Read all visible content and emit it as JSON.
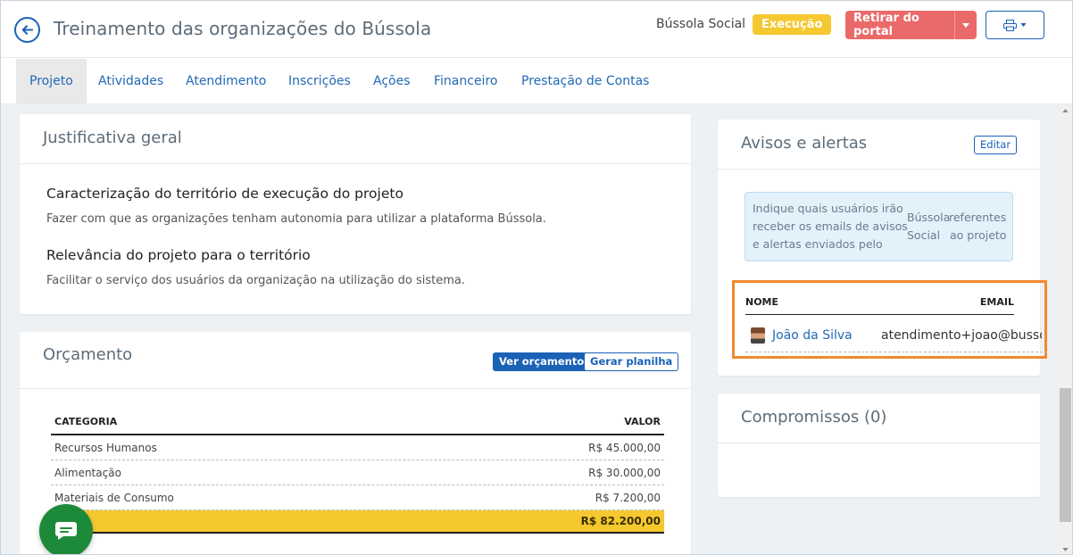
{
  "header": {
    "title": "Treinamento das organizações do Bússola",
    "org_name": "Bússola Social",
    "status": "Execução",
    "portal_button": "Retirar do portal",
    "icons": {
      "back": "arrow-left-circle-icon",
      "print": "printer-icon",
      "caret": "chevron-down-icon"
    }
  },
  "tabs": [
    {
      "label": "Projeto",
      "active": true
    },
    {
      "label": "Atividades"
    },
    {
      "label": "Atendimento"
    },
    {
      "label": "Inscrições"
    },
    {
      "label": "Ações"
    },
    {
      "label": "Financeiro"
    },
    {
      "label": "Prestação de Contas"
    }
  ],
  "justificativa": {
    "title": "Justificativa geral",
    "sections": [
      {
        "heading": "Caracterização do território de execução do projeto",
        "text": "Fazer com que as organizações tenham autonomia para utilizar a plataforma Bússola."
      },
      {
        "heading": "Relevância do projeto para o território",
        "text": "Facilitar o serviço dos usuários da organização na utilização do sistema."
      }
    ]
  },
  "orcamento": {
    "title": "Orçamento",
    "view_button": "Ver orçamento",
    "sheet_button": "Gerar planilha",
    "columns": [
      "CATEGORIA",
      "VALOR"
    ],
    "rows": [
      {
        "category": "Recursos Humanos",
        "value": "R$ 45.000,00"
      },
      {
        "category": "Alimentação",
        "value": "R$ 30.000,00"
      },
      {
        "category": "Materiais de Consumo",
        "value": "R$ 7.200,00"
      }
    ],
    "total": "R$ 82.200,00"
  },
  "avisos": {
    "title": "Avisos e alertas",
    "edit_button": "Editar",
    "info_col1": [
      "Indique quais usuários irão",
      "receber os emails de avisos",
      "e alertas enviados pelo"
    ],
    "info_col2": [
      "Bússola",
      "Social"
    ],
    "info_col3": [
      "referentes",
      "ao projeto"
    ],
    "columns": [
      "NOME",
      "EMAIL"
    ],
    "recipients": [
      {
        "name": "João da Silva",
        "email": "atendimento+joao@bussola"
      }
    ]
  },
  "compromissos": {
    "title": "Compromissos (0)"
  },
  "colors": {
    "primary": "#1a62b6",
    "warning": "#f5c830",
    "danger": "#ea6a6a",
    "highlight": "#f08a2e",
    "chat": "#1d8a3a"
  }
}
